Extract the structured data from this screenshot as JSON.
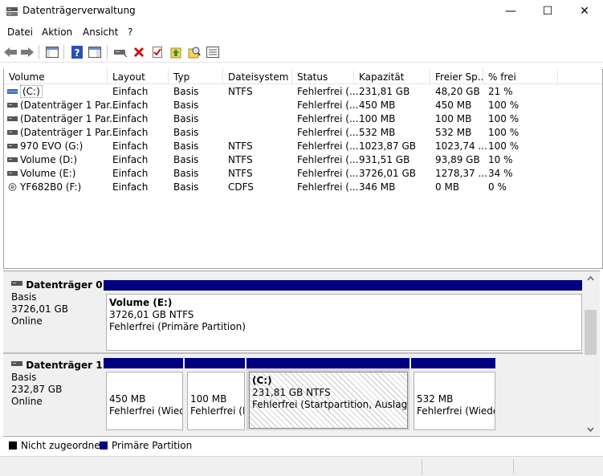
{
  "window": {
    "title": "Datenträgerverwaltung",
    "minimize": "—",
    "maximize": "☐",
    "close": "✕"
  },
  "menu": [
    "Datei",
    "Aktion",
    "Ansicht",
    "?"
  ],
  "columns": [
    "Volume",
    "Layout",
    "Typ",
    "Dateisystem",
    "Status",
    "Kapazität",
    "Freier Sp...",
    "% frei"
  ],
  "volumes": [
    {
      "volume": "(C:)",
      "layout": "Einfach",
      "type": "Basis",
      "fs": "NTFS",
      "status": "Fehlerfrei (...",
      "capacity": "231,81 GB",
      "free": "48,20 GB",
      "pct": "21 %",
      "icon": "volume-striped-icon"
    },
    {
      "volume": "(Datenträger 1 Par...",
      "layout": "Einfach",
      "type": "Basis",
      "fs": "",
      "status": "Fehlerfrei (...",
      "capacity": "450 MB",
      "free": "450 MB",
      "pct": "100 %",
      "icon": "disk-volume-icon"
    },
    {
      "volume": "(Datenträger 1 Par...",
      "layout": "Einfach",
      "type": "Basis",
      "fs": "",
      "status": "Fehlerfrei (...",
      "capacity": "100 MB",
      "free": "100 MB",
      "pct": "100 %",
      "icon": "disk-volume-icon"
    },
    {
      "volume": "(Datenträger 1 Par...",
      "layout": "Einfach",
      "type": "Basis",
      "fs": "",
      "status": "Fehlerfrei (...",
      "capacity": "532 MB",
      "free": "532 MB",
      "pct": "100 %",
      "icon": "disk-volume-icon"
    },
    {
      "volume": "970 EVO (G:)",
      "layout": "Einfach",
      "type": "Basis",
      "fs": "NTFS",
      "status": "Fehlerfrei (...",
      "capacity": "1023,87 GB",
      "free": "1023,74 ...",
      "pct": "100 %",
      "icon": "disk-volume-icon"
    },
    {
      "volume": "Volume (D:)",
      "layout": "Einfach",
      "type": "Basis",
      "fs": "NTFS",
      "status": "Fehlerfrei (...",
      "capacity": "931,51 GB",
      "free": "93,89 GB",
      "pct": "10 %",
      "icon": "disk-volume-icon"
    },
    {
      "volume": "Volume (E:)",
      "layout": "Einfach",
      "type": "Basis",
      "fs": "NTFS",
      "status": "Fehlerfrei (...",
      "capacity": "3726,01 GB",
      "free": "1278,37 ...",
      "pct": "34 %",
      "icon": "disk-volume-icon"
    },
    {
      "volume": "YF682B0 (F:)",
      "layout": "Einfach",
      "type": "Basis",
      "fs": "CDFS",
      "status": "Fehlerfrei (...",
      "capacity": "346 MB",
      "free": "0 MB",
      "pct": "0 %",
      "icon": "cd-rom-icon"
    }
  ],
  "disks": [
    {
      "name": "Datenträger 0",
      "type": "Basis",
      "size": "3726,01 GB",
      "state": "Online",
      "partitions": [
        {
          "name": "Volume  (E:)",
          "size": "3726,01 GB NTFS",
          "status": "Fehlerfrei (Primäre Partition)"
        }
      ]
    },
    {
      "name": "Datenträger 1",
      "type": "Basis",
      "size": "232,87 GB",
      "state": "Online",
      "partitions": [
        {
          "name": "",
          "size": "450 MB",
          "status": "Fehlerfrei (Wiederherstellungspartition)"
        },
        {
          "name": "",
          "size": "100 MB",
          "status": "Fehlerfrei (EFI-Systempartition)"
        },
        {
          "name": "(C:)",
          "size": "231,81 GB NTFS",
          "status": "Fehlerfrei (Startpartition, Auslagerungsdatei)"
        },
        {
          "name": "",
          "size": "532 MB",
          "status": "Fehlerfrei (Wiederherstellungspartition)"
        }
      ]
    }
  ],
  "legend": [
    {
      "label": "Nicht zugeordnet",
      "color": "#000000"
    },
    {
      "label": "Primäre Partition",
      "color": "#000080"
    }
  ],
  "toolbar_icons": [
    "back-icon",
    "forward-icon",
    "console-tree-icon",
    "help-icon",
    "action-pane-icon",
    "connect-disk-icon",
    "delete-icon",
    "properties-icon",
    "refresh-icon",
    "search-icon",
    "list-view-icon"
  ]
}
